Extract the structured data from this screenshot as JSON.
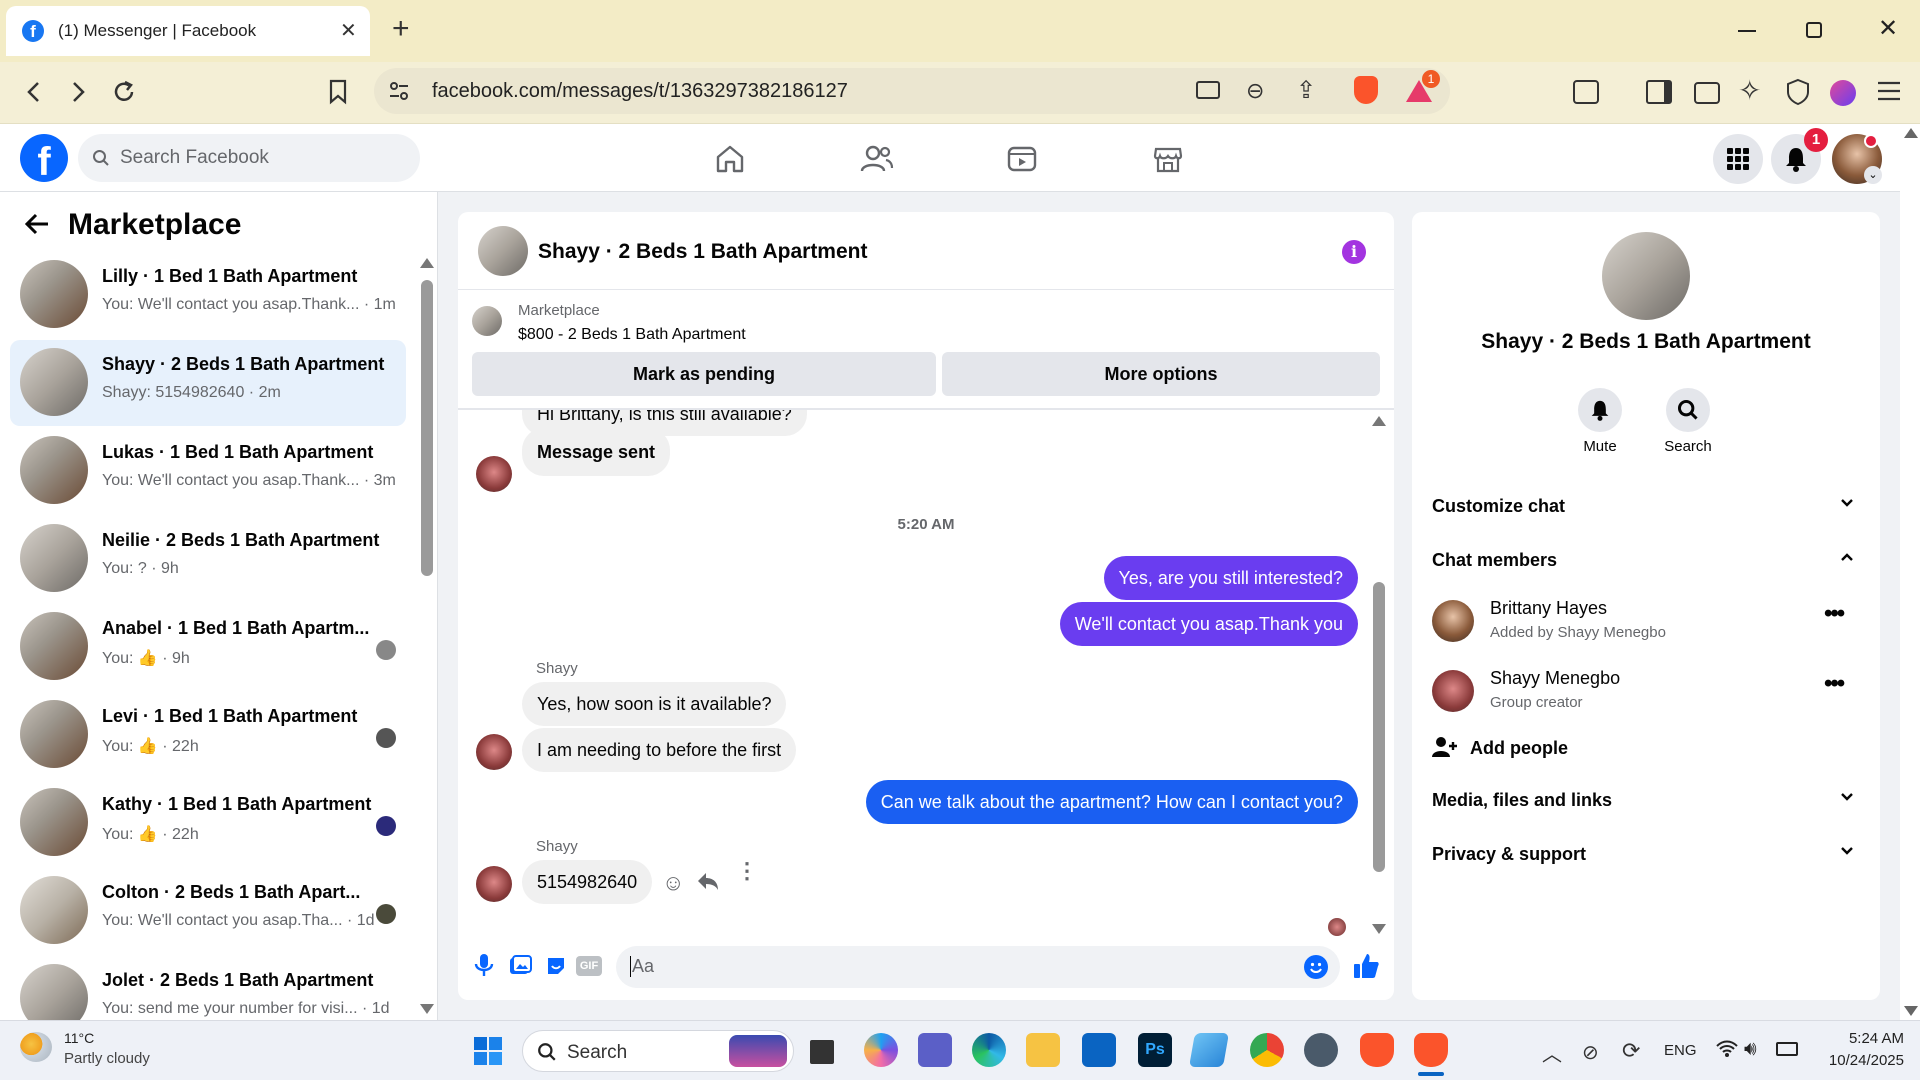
{
  "browser": {
    "tab_title": "(1) Messenger | Facebook",
    "url": "facebook.com/messages/t/1363297382186127",
    "ext_badge": "1"
  },
  "fb": {
    "search_placeholder": "Search Facebook",
    "notif_badge": "1"
  },
  "left": {
    "header": "Marketplace",
    "conversations": [
      {
        "title": "Lilly · 1 Bed 1 Bath Apartment",
        "sub": "You: We'll contact you asap.Thank... · 1m"
      },
      {
        "title": "Shayy · 2 Beds 1 Bath Apartment",
        "sub": "Shayy: 5154982640 · 2m"
      },
      {
        "title": "Lukas · 1 Bed 1 Bath Apartment",
        "sub": "You: We'll contact you asap.Thank... · 3m"
      },
      {
        "title": "Neilie · 2 Beds 1 Bath Apartment",
        "sub": "You: ? · 9h"
      },
      {
        "title": "Anabel · 1 Bed 1 Bath Apartm...",
        "sub": "You: 👍 · 9h"
      },
      {
        "title": "Levi · 1 Bed 1 Bath Apartment",
        "sub": "You: 👍 · 22h"
      },
      {
        "title": "Kathy · 1 Bed 1 Bath Apartment",
        "sub": "You: 👍 · 22h"
      },
      {
        "title": "Colton · 2 Beds 1 Bath Apart...",
        "sub": "You: We'll contact you asap.Tha... · 1d"
      },
      {
        "title": "Jolet · 2 Beds 1 Bath Apartment",
        "sub": "You: send me your number for visi... · 1d"
      }
    ]
  },
  "chat": {
    "title": "Shayy · 2 Beds 1 Bath Apartment",
    "listing_source": "Marketplace",
    "listing_title": "$800 - 2 Beds 1 Bath Apartment",
    "mark_pending": "Mark as pending",
    "more_options": "More options",
    "messages": {
      "m0": "Hi Brittany, is this still available?",
      "m1": "Message sent",
      "time": "5:20 AM",
      "m2": "Yes, are you still interested?",
      "m3": "We'll contact you asap.Thank you",
      "sender1": "Shayy",
      "m4": "Yes, how soon is it available?",
      "m5": "I am needing to before the first",
      "m6": "Can we talk about the apartment? How can I contact you?",
      "sender2": "Shayy",
      "m7": "5154982640"
    },
    "composer_placeholder": "Aa"
  },
  "right": {
    "name": "Shayy · 2 Beds 1 Bath Apartment",
    "mute": "Mute",
    "search": "Search",
    "customize": "Customize chat",
    "members_header": "Chat members",
    "members": [
      {
        "name": "Brittany Hayes",
        "sub": "Added by Shayy Menegbo"
      },
      {
        "name": "Shayy Menegbo",
        "sub": "Group creator"
      }
    ],
    "add_people": "Add people",
    "media": "Media, files and links",
    "privacy": "Privacy & support"
  },
  "taskbar": {
    "temp": "11°C",
    "weather": "Partly cloudy",
    "search": "Search",
    "lang": "ENG",
    "time": "5:24 AM",
    "date": "10/24/2025"
  }
}
